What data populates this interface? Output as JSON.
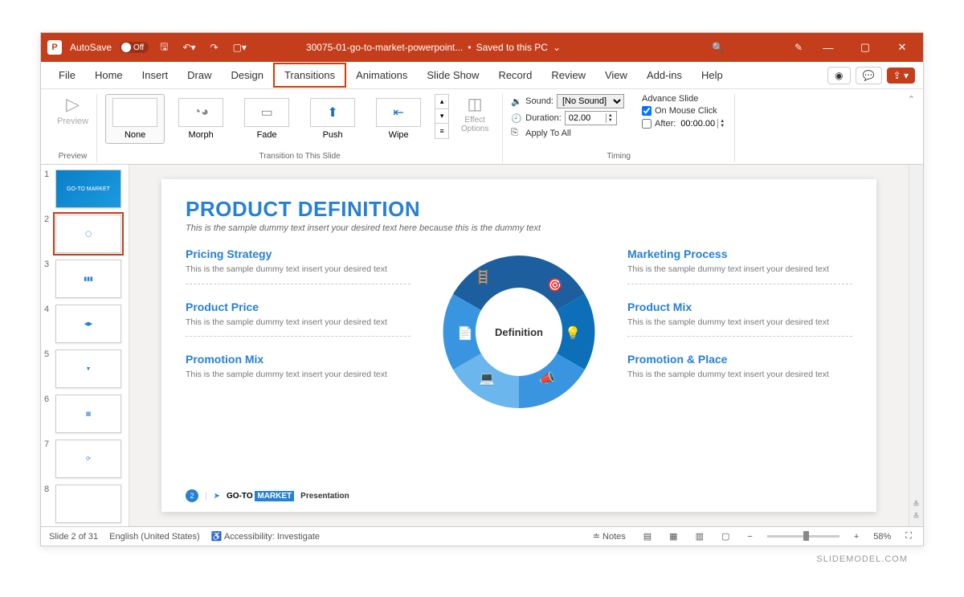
{
  "titlebar": {
    "autosave_label": "AutoSave",
    "autosave_state": "Off",
    "doc_name": "30075-01-go-to-market-powerpoint...",
    "save_state": "Saved to this PC"
  },
  "tabs": [
    "File",
    "Home",
    "Insert",
    "Draw",
    "Design",
    "Transitions",
    "Animations",
    "Slide Show",
    "Record",
    "Review",
    "View",
    "Add-ins",
    "Help"
  ],
  "active_tab_index": 5,
  "ribbon": {
    "preview_group": "Preview",
    "preview_btn": "Preview",
    "transition_group": "Transition to This Slide",
    "transitions": [
      "None",
      "Morph",
      "Fade",
      "Push",
      "Wipe"
    ],
    "selected_transition": 0,
    "effect_options": "Effect Options",
    "timing_group": "Timing",
    "sound_label": "Sound:",
    "sound_value": "[No Sound]",
    "duration_label": "Duration:",
    "duration_value": "02.00",
    "apply_all": "Apply To All",
    "advance_label": "Advance Slide",
    "on_click": "On Mouse Click",
    "on_click_checked": true,
    "after_label": "After:",
    "after_value": "00:00.00",
    "after_checked": false
  },
  "thumbs": [
    1,
    2,
    3,
    4,
    5,
    6,
    7,
    8
  ],
  "selected_thumb": 2,
  "slide": {
    "title": "PRODUCT DEFINITION",
    "subtitle": "This is the sample dummy text insert your desired text here because this is the dummy text",
    "center": "Definition",
    "left": [
      {
        "h": "Pricing Strategy",
        "p": "This is the sample dummy text insert your desired text"
      },
      {
        "h": "Product Price",
        "p": "This is the sample dummy text insert your desired text"
      },
      {
        "h": "Promotion Mix",
        "p": "This is the sample dummy text insert your desired text"
      }
    ],
    "right": [
      {
        "h": "Marketing Process",
        "p": "This is the sample dummy text insert your desired text"
      },
      {
        "h": "Product Mix",
        "p": "This is the sample dummy text insert your desired text"
      },
      {
        "h": "Promotion & Place",
        "p": "This is the sample dummy text insert your desired text"
      }
    ],
    "footer_page": "2",
    "footer_brand1": "GO-TO",
    "footer_brand2": "MARKET",
    "footer_text": "Presentation"
  },
  "status": {
    "slide": "Slide 2 of 31",
    "lang": "English (United States)",
    "access": "Accessibility: Investigate",
    "notes": "Notes",
    "zoom": "58%"
  },
  "watermark": "SLIDEMODEL.COM"
}
